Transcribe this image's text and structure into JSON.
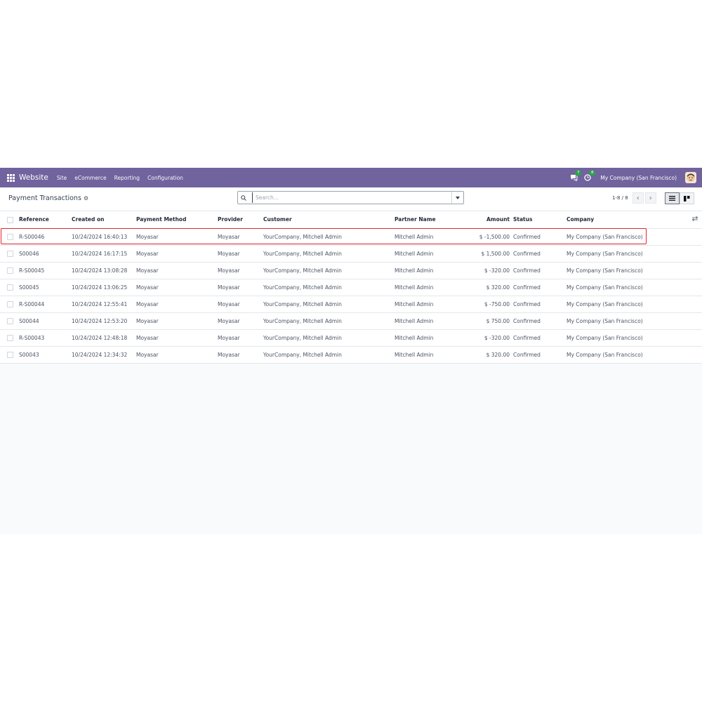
{
  "navbar": {
    "brand": "Website",
    "menu": [
      "Site",
      "eCommerce",
      "Reporting",
      "Configuration"
    ],
    "messages_count": "7",
    "activities_count": "8",
    "company": "My Company (San Francisco)"
  },
  "control_panel": {
    "title": "Payment Transactions",
    "search_placeholder": "Search...",
    "pager": "1-8 / 8"
  },
  "table": {
    "headers": {
      "reference": "Reference",
      "created_on": "Created on",
      "payment_method": "Payment Method",
      "provider": "Provider",
      "customer": "Customer",
      "partner_name": "Partner Name",
      "amount": "Amount",
      "status": "Status",
      "company": "Company"
    },
    "rows": [
      {
        "reference": "R-S00046",
        "created_on": "10/24/2024 16:40:13",
        "payment_method": "Moyasar",
        "provider": "Moyasar",
        "customer": "YourCompany, Mitchell Admin",
        "partner_name": "Mitchell Admin",
        "amount": "$ -1,500.00",
        "status": "Confirmed",
        "company": "My Company (San Francisco)"
      },
      {
        "reference": "S00046",
        "created_on": "10/24/2024 16:17:15",
        "payment_method": "Moyasar",
        "provider": "Moyasar",
        "customer": "YourCompany, Mitchell Admin",
        "partner_name": "Mitchell Admin",
        "amount": "$ 1,500.00",
        "status": "Confirmed",
        "company": "My Company (San Francisco)"
      },
      {
        "reference": "R-S00045",
        "created_on": "10/24/2024 13:08:28",
        "payment_method": "Moyasar",
        "provider": "Moyasar",
        "customer": "YourCompany, Mitchell Admin",
        "partner_name": "Mitchell Admin",
        "amount": "$ -320.00",
        "status": "Confirmed",
        "company": "My Company (San Francisco)"
      },
      {
        "reference": "S00045",
        "created_on": "10/24/2024 13:06:25",
        "payment_method": "Moyasar",
        "provider": "Moyasar",
        "customer": "YourCompany, Mitchell Admin",
        "partner_name": "Mitchell Admin",
        "amount": "$ 320.00",
        "status": "Confirmed",
        "company": "My Company (San Francisco)"
      },
      {
        "reference": "R-S00044",
        "created_on": "10/24/2024 12:55:41",
        "payment_method": "Moyasar",
        "provider": "Moyasar",
        "customer": "YourCompany, Mitchell Admin",
        "partner_name": "Mitchell Admin",
        "amount": "$ -750.00",
        "status": "Confirmed",
        "company": "My Company (San Francisco)"
      },
      {
        "reference": "S00044",
        "created_on": "10/24/2024 12:53:20",
        "payment_method": "Moyasar",
        "provider": "Moyasar",
        "customer": "YourCompany, Mitchell Admin",
        "partner_name": "Mitchell Admin",
        "amount": "$ 750.00",
        "status": "Confirmed",
        "company": "My Company (San Francisco)"
      },
      {
        "reference": "R-S00043",
        "created_on": "10/24/2024 12:48:18",
        "payment_method": "Moyasar",
        "provider": "Moyasar",
        "customer": "YourCompany, Mitchell Admin",
        "partner_name": "Mitchell Admin",
        "amount": "$ -320.00",
        "status": "Confirmed",
        "company": "My Company (San Francisco)"
      },
      {
        "reference": "S00043",
        "created_on": "10/24/2024 12:34:32",
        "payment_method": "Moyasar",
        "provider": "Moyasar",
        "customer": "YourCompany, Mitchell Admin",
        "partner_name": "Mitchell Admin",
        "amount": "$ 320.00",
        "status": "Confirmed",
        "company": "My Company (San Francisco)"
      }
    ]
  },
  "colors": {
    "navbar": "#71639e",
    "highlight": "#e3242b",
    "badge": "#28a745"
  }
}
